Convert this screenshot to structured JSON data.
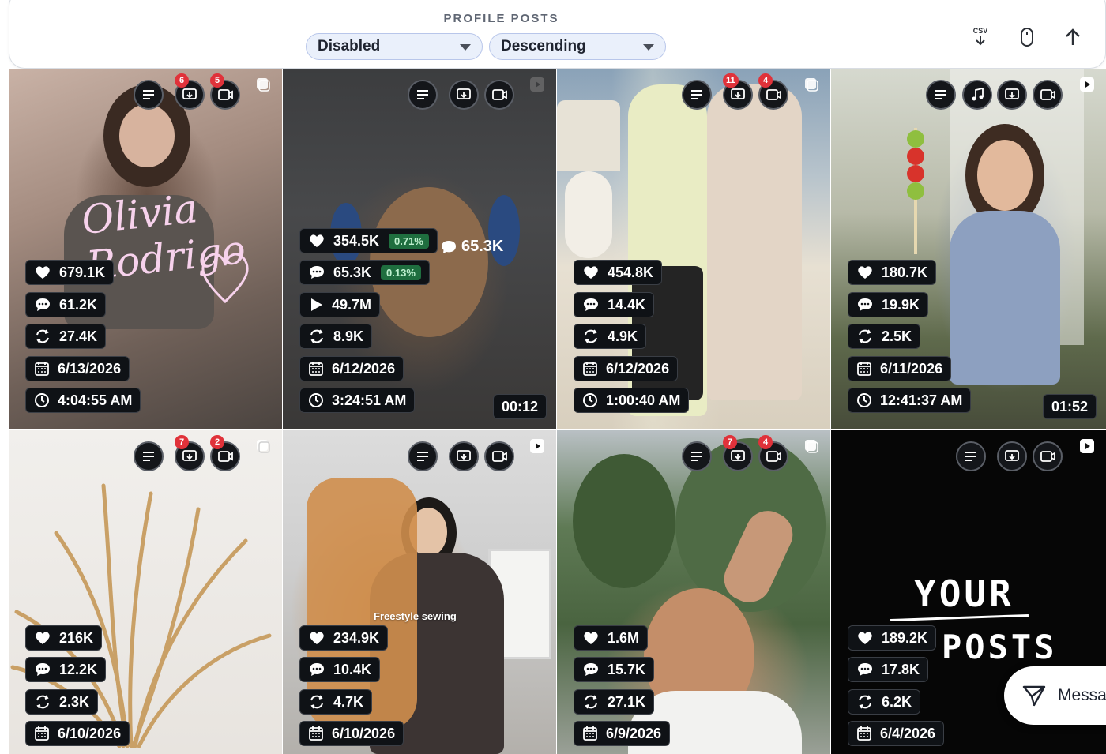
{
  "header": {
    "title": "PROFILE POSTS",
    "filter_select": "Disabled",
    "sort_select": "Descending",
    "csv_label": "CSV"
  },
  "posts": [
    {
      "badges": [
        "6",
        "5"
      ],
      "likes": "679.1K",
      "comments": "61.2K",
      "reposts": "27.4K",
      "date": "6/13/2026",
      "time": "4:04:55 AM",
      "overlay": "Olivia Rodrigo"
    },
    {
      "likes": "354.5K",
      "likes_pct": "0.71%",
      "comments": "65.3K",
      "comments_pct": "0.13%",
      "views": "49.7M",
      "reposts": "8.9K",
      "date": "6/12/2026",
      "time": "3:24:51 AM",
      "duration": "00:12",
      "bubble": "65.3K"
    },
    {
      "badges": [
        "11",
        "4"
      ],
      "likes": "454.8K",
      "comments": "14.4K",
      "reposts": "4.9K",
      "date": "6/12/2026",
      "time": "1:00:40 AM"
    },
    {
      "likes": "180.7K",
      "comments": "19.9K",
      "reposts": "2.5K",
      "date": "6/11/2026",
      "time": "12:41:37 AM",
      "duration": "01:52"
    },
    {
      "badges": [
        "7",
        "2"
      ],
      "likes": "216K",
      "comments": "12.2K",
      "reposts": "2.3K",
      "date": "6/10/2026"
    },
    {
      "likes": "234.9K",
      "comments": "10.4K",
      "reposts": "4.7K",
      "date": "6/10/2026",
      "caption": "Freestyle sewing"
    },
    {
      "badges": [
        "7",
        "4"
      ],
      "likes": "1.6M",
      "comments": "15.7K",
      "reposts": "27.1K",
      "date": "6/9/2026"
    },
    {
      "likes": "189.2K",
      "comments": "17.8K",
      "reposts": "6.2K",
      "date": "6/4/2026",
      "overlay_line1": "YOUR",
      "overlay_line2": "POSTS"
    }
  ],
  "message_button": "Message"
}
